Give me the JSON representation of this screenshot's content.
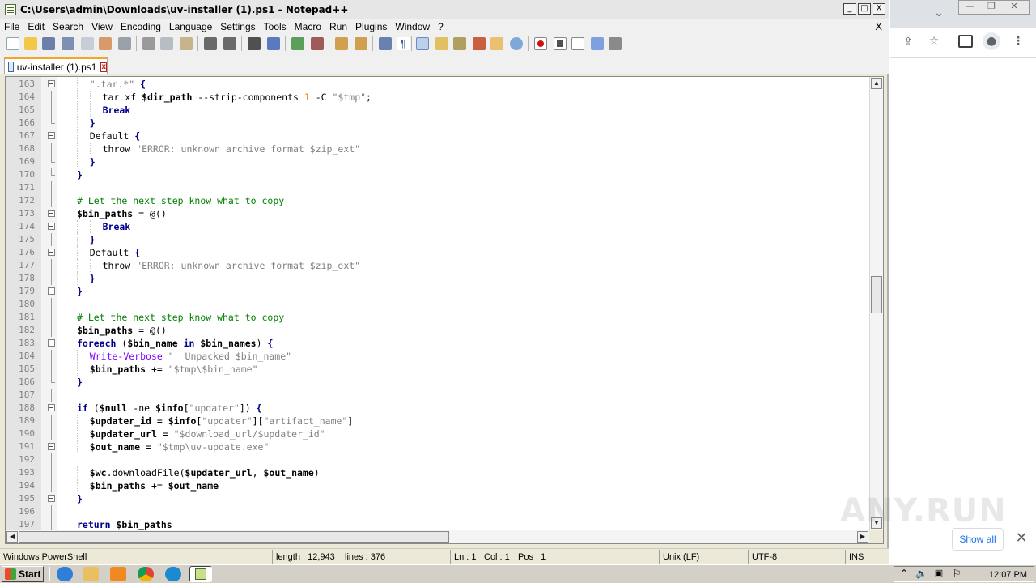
{
  "window": {
    "title": "C:\\Users\\admin\\Downloads\\uv-installer (1).ps1 - Notepad++",
    "controls": {
      "minimize": "_",
      "maximize": "□",
      "close": "X"
    }
  },
  "menu": {
    "items": [
      "File",
      "Edit",
      "Search",
      "View",
      "Encoding",
      "Language",
      "Settings",
      "Tools",
      "Macro",
      "Run",
      "Plugins",
      "Window",
      "?"
    ],
    "close_label": "X"
  },
  "tab": {
    "label": "uv-installer (1).ps1",
    "close_label": "x"
  },
  "editor": {
    "lines": [
      {
        "n": "163",
        "fold": "open",
        "indent": 1,
        "parts": [
          [
            "str",
            "\".tar.*\""
          ],
          [
            "plain",
            " "
          ],
          [
            "op",
            "{"
          ]
        ]
      },
      {
        "n": "164",
        "fold": "line",
        "indent": 2,
        "parts": [
          [
            "plain",
            "tar xf "
          ],
          [
            "var",
            "$dir_path"
          ],
          [
            "plain",
            " --strip-components "
          ],
          [
            "num",
            "1"
          ],
          [
            "plain",
            " -C "
          ],
          [
            "str",
            "\"$tmp\""
          ],
          [
            "plain",
            ";"
          ]
        ]
      },
      {
        "n": "165",
        "fold": "line",
        "indent": 2,
        "parts": [
          [
            "kw",
            "Break"
          ]
        ]
      },
      {
        "n": "166",
        "fold": "end",
        "indent": 1,
        "parts": [
          [
            "op",
            "}"
          ]
        ]
      },
      {
        "n": "167",
        "fold": "open",
        "indent": 1,
        "parts": [
          [
            "plain",
            "Default "
          ],
          [
            "op",
            "{"
          ]
        ]
      },
      {
        "n": "168",
        "fold": "line",
        "indent": 2,
        "parts": [
          [
            "plain",
            "throw "
          ],
          [
            "str",
            "\"ERROR: unknown archive format $zip_ext\""
          ]
        ]
      },
      {
        "n": "169",
        "fold": "end",
        "indent": 1,
        "parts": [
          [
            "op",
            "}"
          ]
        ]
      },
      {
        "n": "170",
        "fold": "end",
        "indent": 0,
        "parts": [
          [
            "op",
            "}"
          ]
        ]
      },
      {
        "n": "171",
        "fold": "line",
        "indent": 0,
        "parts": []
      },
      {
        "n": "172",
        "fold": "line",
        "indent": 0,
        "parts": [
          [
            "com",
            "# Let the next step know what to copy"
          ]
        ]
      },
      {
        "n": "173",
        "fold": "open",
        "indent": 0,
        "parts": [
          [
            "var",
            "$bin_paths"
          ],
          [
            "plain",
            " = "
          ],
          [
            "plain",
            "@()"
          ]
        ]
      },
      {
        "n": "174",
        "fold": "open",
        "indent": 2,
        "parts": [
          [
            "kw",
            "Break"
          ]
        ]
      },
      {
        "n": "175",
        "fold": "line",
        "indent": 1,
        "parts": [
          [
            "op",
            "}"
          ]
        ]
      },
      {
        "n": "176",
        "fold": "open",
        "indent": 1,
        "parts": [
          [
            "plain",
            "Default "
          ],
          [
            "op",
            "{"
          ]
        ]
      },
      {
        "n": "177",
        "fold": "line",
        "indent": 2,
        "parts": [
          [
            "plain",
            "throw "
          ],
          [
            "str",
            "\"ERROR: unknown archive format $zip_ext\""
          ]
        ]
      },
      {
        "n": "178",
        "fold": "line",
        "indent": 1,
        "parts": [
          [
            "op",
            "}"
          ]
        ]
      },
      {
        "n": "179",
        "fold": "open",
        "indent": 0,
        "parts": [
          [
            "op",
            "}"
          ]
        ]
      },
      {
        "n": "180",
        "fold": "line",
        "indent": 0,
        "parts": []
      },
      {
        "n": "181",
        "fold": "line",
        "indent": 0,
        "parts": [
          [
            "com",
            "# Let the next step know what to copy"
          ]
        ]
      },
      {
        "n": "182",
        "fold": "line",
        "indent": 0,
        "parts": [
          [
            "var",
            "$bin_paths"
          ],
          [
            "plain",
            " = "
          ],
          [
            "plain",
            "@()"
          ]
        ]
      },
      {
        "n": "183",
        "fold": "open",
        "indent": 0,
        "parts": [
          [
            "kw",
            "foreach"
          ],
          [
            "plain",
            " ("
          ],
          [
            "var",
            "$bin_name"
          ],
          [
            "plain",
            " "
          ],
          [
            "kw",
            "in"
          ],
          [
            "plain",
            " "
          ],
          [
            "var",
            "$bin_names"
          ],
          [
            "plain",
            ") "
          ],
          [
            "op",
            "{"
          ]
        ]
      },
      {
        "n": "184",
        "fold": "line",
        "indent": 1,
        "parts": [
          [
            "cmd",
            "Write-Verbose"
          ],
          [
            "plain",
            " "
          ],
          [
            "str",
            "\"  Unpacked $bin_name\""
          ]
        ]
      },
      {
        "n": "185",
        "fold": "line",
        "indent": 1,
        "parts": [
          [
            "var",
            "$bin_paths"
          ],
          [
            "plain",
            " += "
          ],
          [
            "str",
            "\"$tmp\\$bin_name\""
          ]
        ]
      },
      {
        "n": "186",
        "fold": "end",
        "indent": 0,
        "parts": [
          [
            "op",
            "}"
          ]
        ]
      },
      {
        "n": "187",
        "fold": "line",
        "indent": 0,
        "parts": []
      },
      {
        "n": "188",
        "fold": "open",
        "indent": 0,
        "parts": [
          [
            "kw",
            "if"
          ],
          [
            "plain",
            " ("
          ],
          [
            "var",
            "$null"
          ],
          [
            "plain",
            " -ne "
          ],
          [
            "var",
            "$info"
          ],
          [
            "plain",
            "["
          ],
          [
            "str",
            "\"updater\""
          ],
          [
            "plain",
            "]) "
          ],
          [
            "op",
            "{"
          ]
        ]
      },
      {
        "n": "189",
        "fold": "line",
        "indent": 1,
        "parts": [
          [
            "var",
            "$updater_id"
          ],
          [
            "plain",
            " = "
          ],
          [
            "var",
            "$info"
          ],
          [
            "plain",
            "["
          ],
          [
            "str",
            "\"updater\""
          ],
          [
            "plain",
            "]["
          ],
          [
            "str",
            "\"artifact_name\""
          ],
          [
            "plain",
            "]"
          ]
        ]
      },
      {
        "n": "190",
        "fold": "line",
        "indent": 1,
        "parts": [
          [
            "var",
            "$updater_url"
          ],
          [
            "plain",
            " = "
          ],
          [
            "str",
            "\"$download_url/$updater_id\""
          ]
        ]
      },
      {
        "n": "191",
        "fold": "open",
        "indent": 1,
        "parts": [
          [
            "var",
            "$out_name"
          ],
          [
            "plain",
            " = "
          ],
          [
            "str",
            "\"$tmp\\uv-update.exe\""
          ]
        ]
      },
      {
        "n": "192",
        "fold": "line",
        "indent": 0,
        "parts": []
      },
      {
        "n": "193",
        "fold": "line",
        "indent": 1,
        "parts": [
          [
            "var",
            "$wc"
          ],
          [
            "plain",
            ".downloadFile("
          ],
          [
            "var",
            "$updater_url"
          ],
          [
            "plain",
            ", "
          ],
          [
            "var",
            "$out_name"
          ],
          [
            "plain",
            ")"
          ]
        ]
      },
      {
        "n": "194",
        "fold": "line",
        "indent": 1,
        "parts": [
          [
            "var",
            "$bin_paths"
          ],
          [
            "plain",
            " += "
          ],
          [
            "var",
            "$out_name"
          ]
        ]
      },
      {
        "n": "195",
        "fold": "open",
        "indent": 0,
        "parts": [
          [
            "op",
            "}"
          ]
        ]
      },
      {
        "n": "196",
        "fold": "line",
        "indent": 0,
        "parts": []
      },
      {
        "n": "197",
        "fold": "line",
        "indent": 0,
        "parts": [
          [
            "kw",
            "return"
          ],
          [
            "plain",
            " "
          ],
          [
            "var",
            "$bin_paths"
          ]
        ]
      }
    ]
  },
  "statusbar": {
    "lang": "Windows PowerShell",
    "length": "length : 12,943",
    "lines": "lines : 376",
    "ln": "Ln : 1",
    "col": "Col : 1",
    "pos": "Pos : 1",
    "eol": "Unix (LF)",
    "encoding": "UTF-8",
    "mode": "INS"
  },
  "browser": {
    "watermark": "ANY.RUN",
    "show_all": "Show all",
    "close": "✕",
    "icons": [
      "share-icon",
      "star-icon",
      "sidebar-icon",
      "profile-icon",
      "more-icon"
    ]
  },
  "taskbar": {
    "start": "Start",
    "clock": "12:07 PM"
  }
}
